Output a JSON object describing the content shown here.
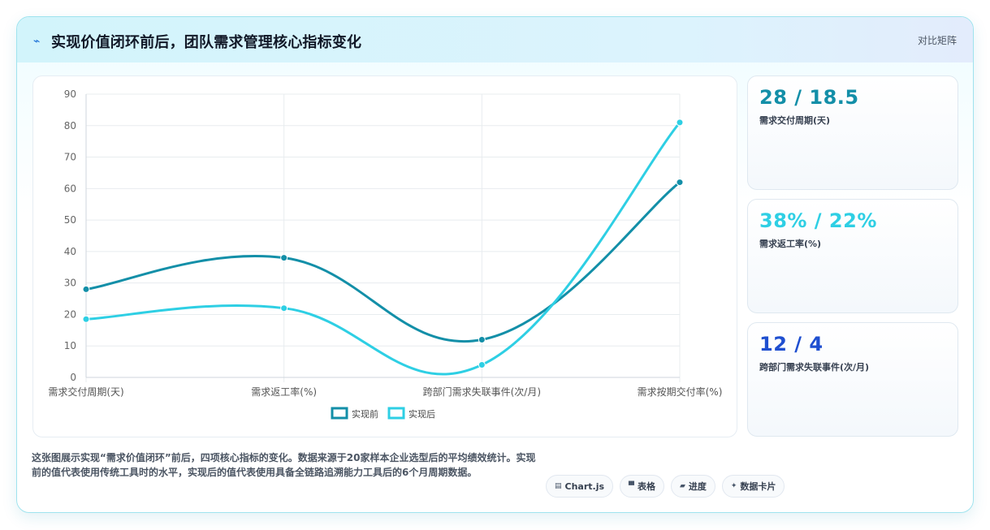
{
  "header": {
    "title_icon": "trend-icon",
    "title": "实现价值闭环前后，团队需求管理核心指标变化",
    "right_label": "对比矩阵"
  },
  "chart_data": {
    "type": "line",
    "categories": [
      "需求交付周期(天)",
      "需求返工率(%)",
      "跨部门需求失联事件(次/月)",
      "需求按期交付率(%)"
    ],
    "series": [
      {
        "name": "实现前",
        "values": [
          28,
          38,
          12,
          62
        ],
        "color": "#138fa8"
      },
      {
        "name": "实现后",
        "values": [
          18.5,
          22,
          4,
          81
        ],
        "color": "#2ecfe4"
      }
    ],
    "ylim": [
      0,
      90
    ],
    "yticks": [
      "0",
      "10",
      "20",
      "30",
      "40",
      "50",
      "60",
      "70",
      "80",
      "90"
    ],
    "grid": true,
    "legend_position": "bottom",
    "smooth": true
  },
  "stats": [
    {
      "value": "28 / 18.5",
      "label": "需求交付周期(天)",
      "color": "#138fa8"
    },
    {
      "value": "38% / 22%",
      "label": "需求返工率(%)",
      "color": "#2ecfe4"
    },
    {
      "value": "12 / 4",
      "label": "跨部门需求失联事件(次/月)",
      "color": "#1f4fd0"
    }
  ],
  "description": "这张图展示实现“需求价值闭环”前后，四项核心指标的变化。数据来源于20家样本企业选型后的平均绩效统计。实现前的值代表使用传统工具时的水平，实现后的值代表使用具备全链路追溯能力工具后的6个月周期数据。",
  "tags": [
    {
      "icon": "▤",
      "icon_name": "chart-icon",
      "label": "Chart.js"
    },
    {
      "icon": "▀",
      "icon_name": "table-icon",
      "label": "表格"
    },
    {
      "icon": "▰",
      "icon_name": "progress-icon",
      "label": "进度"
    },
    {
      "icon": "✦",
      "icon_name": "card-icon",
      "label": "数据卡片"
    }
  ]
}
